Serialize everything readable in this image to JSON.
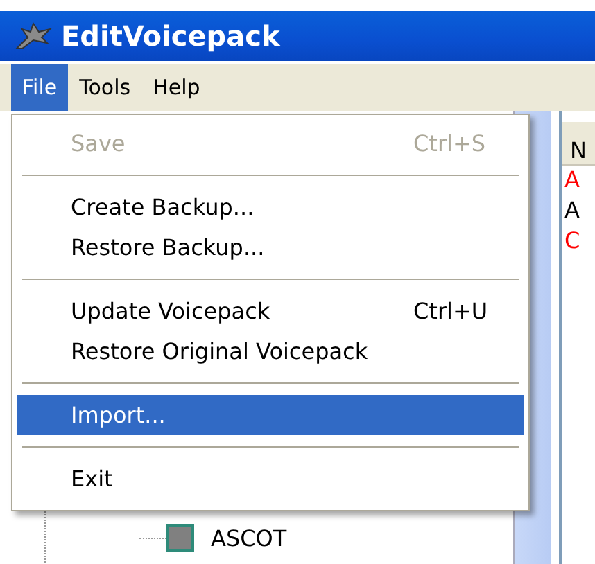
{
  "window": {
    "title": "EditVoicepack"
  },
  "menubar": [
    {
      "label": "File",
      "selected": true
    },
    {
      "label": "Tools",
      "selected": false
    },
    {
      "label": "Help",
      "selected": false
    }
  ],
  "file_menu": [
    {
      "kind": "item",
      "label": "Save",
      "shortcut": "Ctrl+S",
      "disabled": true,
      "selected": false
    },
    {
      "kind": "separator"
    },
    {
      "kind": "item",
      "label": "Create Backup...",
      "disabled": false,
      "selected": false
    },
    {
      "kind": "item",
      "label": "Restore Backup...",
      "disabled": false,
      "selected": false
    },
    {
      "kind": "separator"
    },
    {
      "kind": "item",
      "label": "Update Voicepack",
      "shortcut": "Ctrl+U",
      "disabled": false,
      "selected": false
    },
    {
      "kind": "item",
      "label": "Restore Original Voicepack",
      "disabled": false,
      "selected": false
    },
    {
      "kind": "separator"
    },
    {
      "kind": "item",
      "label": "Import...",
      "disabled": false,
      "selected": true
    },
    {
      "kind": "separator"
    },
    {
      "kind": "item",
      "label": "Exit",
      "disabled": false,
      "selected": false
    }
  ],
  "tree": {
    "items": [
      {
        "label": "ASCOT"
      }
    ]
  },
  "list": {
    "columns": [
      "N"
    ],
    "rows": [
      {
        "text": "A",
        "color": "#ff0000"
      },
      {
        "text": "A",
        "color": "#000000"
      },
      {
        "text": "C",
        "color": "#ff0000"
      }
    ]
  }
}
